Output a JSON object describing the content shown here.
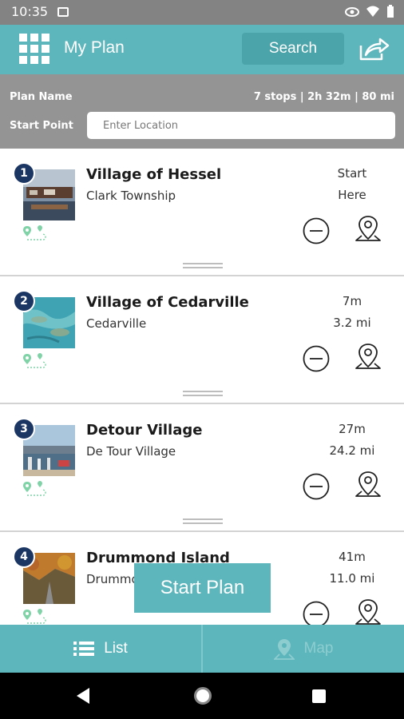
{
  "status_bar": {
    "time": "10:35"
  },
  "app_bar": {
    "title": "My Plan",
    "search_label": "Search"
  },
  "plan": {
    "name_label": "Plan Name",
    "stats": "7 stops | 2h 32m | 80 mi",
    "start_label": "Start Point",
    "start_placeholder": "Enter Location",
    "start_value": ""
  },
  "stops": [
    {
      "number": "1",
      "title": "Village of Hessel",
      "subtitle": "Clark Township",
      "time": "Start",
      "distance": "Here"
    },
    {
      "number": "2",
      "title": "Village of Cedarville",
      "subtitle": "Cedarville",
      "time": "7m",
      "distance": "3.2 mi"
    },
    {
      "number": "3",
      "title": "Detour Village",
      "subtitle": "De Tour Village",
      "time": "27m",
      "distance": "24.2 mi"
    },
    {
      "number": "4",
      "title": "Drummond Island",
      "subtitle": "Drummond Island",
      "time": "41m",
      "distance": "11.0 mi"
    }
  ],
  "start_plan_label": "Start Plan",
  "tabs": {
    "list_label": "List",
    "map_label": "Map"
  },
  "icons": {
    "menu": "grid-menu-icon",
    "share": "share-icon",
    "remove": "minus-circle-icon",
    "pin": "map-pin-icon",
    "route": "route-icon",
    "list": "list-icon",
    "map": "map-marker-icon"
  },
  "colors": {
    "accent": "#5db6bb",
    "badge": "#1c3664",
    "header_gray": "#949494",
    "route_green": "#7fd3a6"
  }
}
